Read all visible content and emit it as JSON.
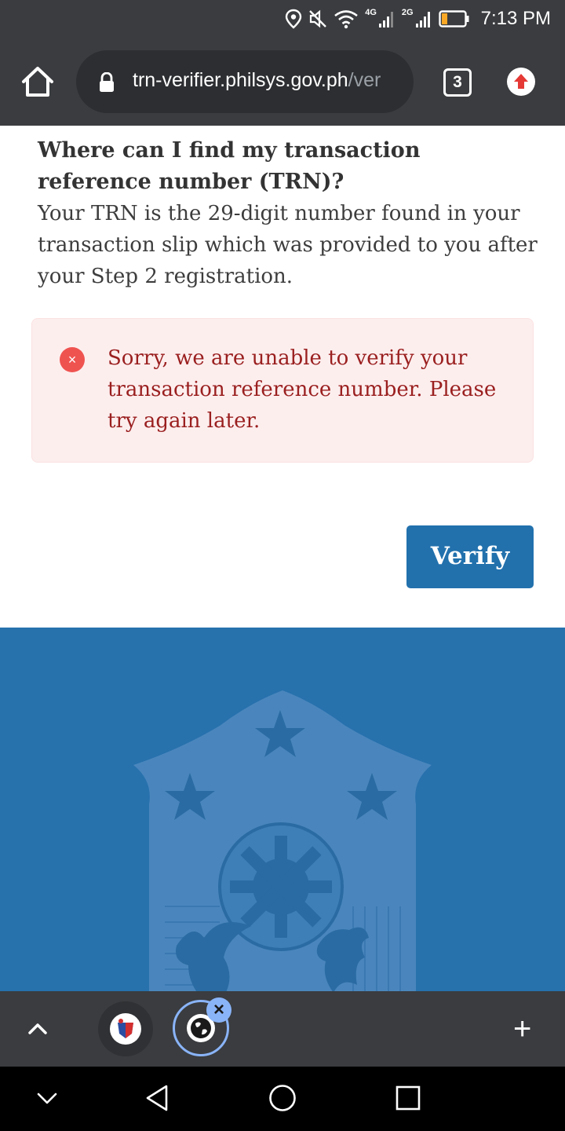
{
  "status_bar": {
    "time": "7:13 PM",
    "network_1": "4G",
    "network_2": "2G",
    "icons": [
      "location-icon",
      "mute-icon",
      "wifi-icon",
      "signal-icon",
      "battery-icon"
    ]
  },
  "browser": {
    "url_domain": "trn-verifier.philsys.gov.ph",
    "url_path": "/ver",
    "tab_count": "3",
    "icons": [
      "home-icon",
      "lock-icon",
      "update-icon"
    ]
  },
  "faq": {
    "question": "Where can I find my transaction reference number (TRN)?",
    "answer": "Your TRN is the 29-digit number found in your transaction slip which was provided to you after your Step 2 registration."
  },
  "alert": {
    "icon": "×",
    "message": "Sorry, we are unable to verify your transaction reference number. Please try again later."
  },
  "form": {
    "verify_label": "Verify"
  },
  "bottom_bar": {
    "new_tab": "+",
    "close_tab": "×"
  },
  "colors": {
    "browser_chrome": "#3a3c3f",
    "alert_background": "#fdeeee",
    "alert_text": "#9a1f1f",
    "primary_button": "#2271ad",
    "footer_background": "#2771ad"
  }
}
